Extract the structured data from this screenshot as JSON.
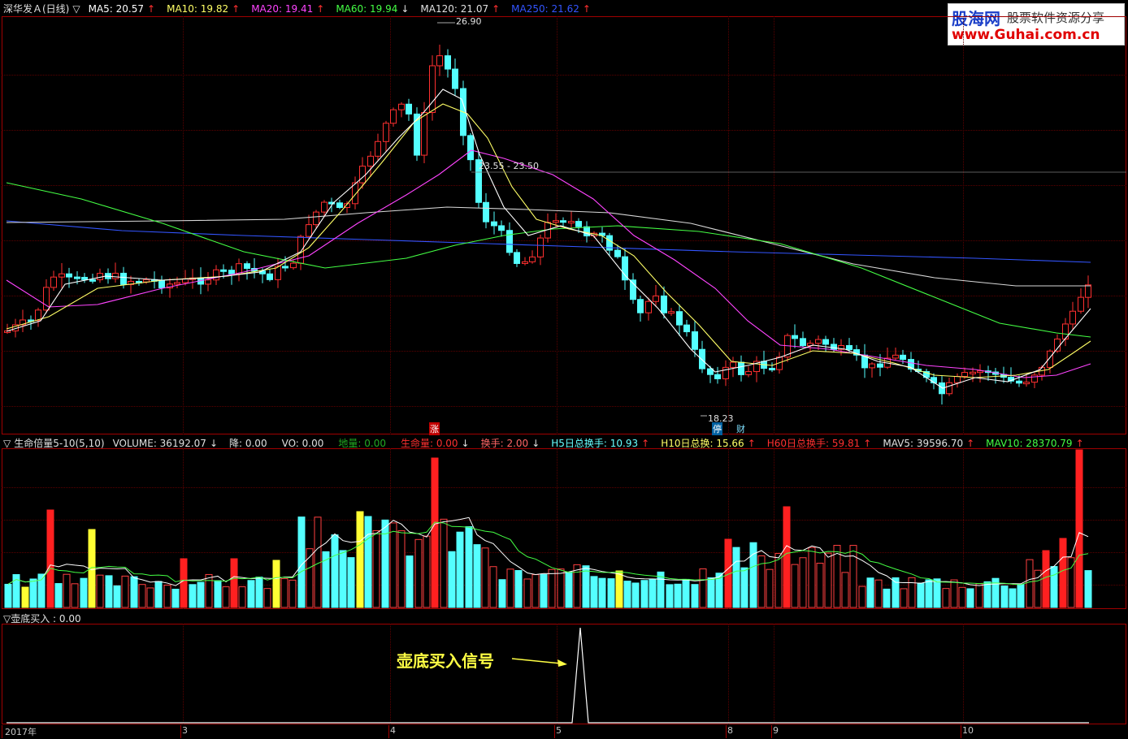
{
  "price_panel": {
    "stock_name": "深华发Ａ(日线)",
    "indicators": [
      {
        "label": "MA5: 20.57",
        "arrow": "↑",
        "color": "#ffffff",
        "arrow_color": "#ff3030"
      },
      {
        "label": "MA10: 19.82",
        "arrow": "↑",
        "color": "#ffff66",
        "arrow_color": "#ff3030"
      },
      {
        "label": "MA20: 19.41",
        "arrow": "↑",
        "color": "#ff44ff",
        "arrow_color": "#ff3030"
      },
      {
        "label": "MA60: 19.94",
        "arrow": "↓",
        "color": "#44ff44",
        "arrow_color": "#e0e0e0"
      },
      {
        "label": "MA120: 21.07",
        "arrow": "↑",
        "color": "#e0e0e0",
        "arrow_color": "#ff3030"
      },
      {
        "label": "MA250: 21.62",
        "arrow": "↑",
        "color": "#3355ff",
        "arrow_color": "#ff3030"
      }
    ],
    "high_label": "26.90",
    "low_label": "18.23",
    "range_label": "23.55 - 23.50",
    "zhang_mark": "涨",
    "ting_mark": "停",
    "cai_mark": "财"
  },
  "volume_panel": {
    "title": "生命倍量5-10(5,10)",
    "items": [
      {
        "label": "VOLUME: 36192.07",
        "arrow": "↓",
        "color": "#e0e0e0",
        "arrow_color": "#e0e0e0"
      },
      {
        "label": "降: 0.00",
        "arrow": "",
        "color": "#e0e0e0",
        "arrow_color": "#e0e0e0"
      },
      {
        "label": "VO: 0.00",
        "arrow": "",
        "color": "#e0e0e0",
        "arrow_color": "#e0e0e0"
      },
      {
        "label": "地量: 0.00",
        "arrow": "",
        "color": "#22aa22",
        "arrow_color": "#22aa22"
      },
      {
        "label": "生命量: 0.00",
        "arrow": "↓",
        "color": "#ff3030",
        "arrow_color": "#e0e0e0"
      },
      {
        "label": "换手: 2.00",
        "arrow": "↓",
        "color": "#ff6666",
        "arrow_color": "#e0e0e0"
      },
      {
        "label": "H5日总换手: 10.93",
        "arrow": "↑",
        "color": "#66ffff",
        "arrow_color": "#ff3030"
      },
      {
        "label": "H10日总换: 15.66",
        "arrow": "↑",
        "color": "#ffff66",
        "arrow_color": "#ff3030"
      },
      {
        "label": "H60日总换手: 59.81",
        "arrow": "↑",
        "color": "#ff3030",
        "arrow_color": "#ff3030"
      },
      {
        "label": "MAV5: 39596.70",
        "arrow": "↑",
        "color": "#e0e0e0",
        "arrow_color": "#ff3030"
      },
      {
        "label": "MAV10: 28370.79",
        "arrow": "↑",
        "color": "#44ff44",
        "arrow_color": "#ff3030"
      }
    ]
  },
  "signal_panel": {
    "title": "壶底买入 : 0.00",
    "annotation": "壶底买入信号"
  },
  "x_axis": [
    "2017年",
    "3",
    "4",
    "5",
    "8",
    "9",
    "10"
  ],
  "logo": {
    "name": "股海网",
    "slogan": "股票软件资源分享",
    "url": "www.Guhai.com.cn"
  },
  "colors": {
    "up": "#ff3030",
    "down": "#54ffff",
    "highlight": "#ffff33",
    "border": "#a00000"
  }
}
